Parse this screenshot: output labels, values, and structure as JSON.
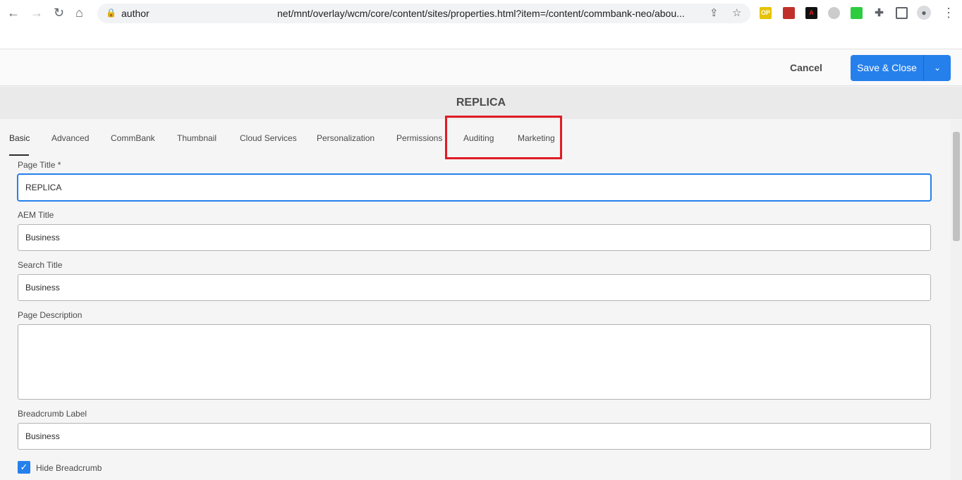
{
  "browser": {
    "host": "author",
    "url_path": "net/mnt/overlay/wcm/core/content/sites/properties.html?item=/content/commbank-neo/abou...",
    "extensions": [
      "OP",
      "",
      "",
      "",
      "",
      "",
      "",
      ""
    ]
  },
  "toolbar": {
    "cancel": "Cancel",
    "save": "Save & Close"
  },
  "page_title": "REPLICA",
  "tabs": [
    "Basic",
    "Advanced",
    "CommBank",
    "Thumbnail",
    "Cloud Services",
    "Personalization",
    "Permissions",
    "Auditing",
    "Marketing"
  ],
  "form": {
    "page_title_label": "Page Title *",
    "page_title_value": "REPLICA",
    "aem_title_label": "AEM Title",
    "aem_title_value": "Business",
    "search_title_label": "Search Title",
    "search_title_value": "Business",
    "description_label": "Page Description",
    "description_value": "",
    "breadcrumb_label": "Breadcrumb Label",
    "breadcrumb_value": "Business",
    "hide_breadcrumb_label": "Hide Breadcrumb",
    "hide_breadcrumb_checked": true
  },
  "colors": {
    "accent": "#2680eb",
    "highlight": "#e01b24"
  }
}
